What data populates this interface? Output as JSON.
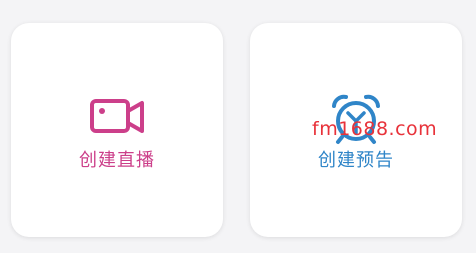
{
  "colors": {
    "live_accent": "#cc3f8a",
    "preview_accent": "#2f85c8",
    "watermark": "#e8323a",
    "background": "#f4f4f6",
    "card": "#ffffff"
  },
  "cards": [
    {
      "label": "创建直播",
      "icon": "video-camera-icon"
    },
    {
      "label": "创建预告",
      "icon": "alarm-clock-icon"
    }
  ],
  "watermark": {
    "text": "fm1688.com"
  }
}
